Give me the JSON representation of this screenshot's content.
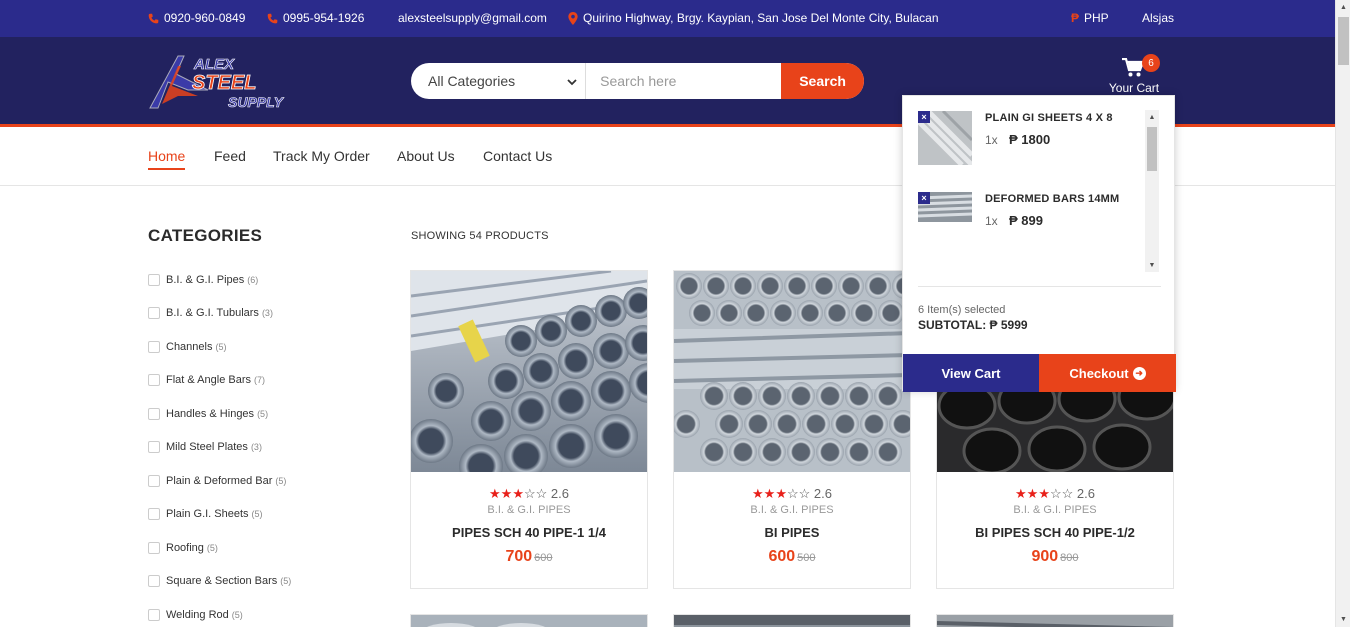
{
  "topbar": {
    "phone1": "0920-960-0849",
    "phone2": "0995-954-1926",
    "email": "alexsteelsupply@gmail.com",
    "address": "Quirino Highway, Brgy. Kaypian, San Jose Del Monte City, Bulacan",
    "currency": "PHP",
    "user": "Alsjas"
  },
  "logo": {
    "line1": "ALEX",
    "line2": "STEEL",
    "line3": "SUPPLY"
  },
  "search": {
    "category_selected": "All Categories",
    "placeholder": "Search here",
    "value": "",
    "button_label": "Search"
  },
  "cart": {
    "count": "6",
    "label": "Your Cart"
  },
  "nav": {
    "items": [
      {
        "label": "Home"
      },
      {
        "label": "Feed"
      },
      {
        "label": "Track My Order"
      },
      {
        "label": "About Us"
      },
      {
        "label": "Contact Us"
      }
    ]
  },
  "sidebar": {
    "title": "CATEGORIES",
    "categories": [
      {
        "label": "B.I. & G.I. Pipes",
        "count": "(6)"
      },
      {
        "label": "B.I. & G.I. Tubulars",
        "count": "(3)"
      },
      {
        "label": "Channels",
        "count": "(5)"
      },
      {
        "label": "Flat & Angle Bars",
        "count": "(7)"
      },
      {
        "label": "Handles & Hinges",
        "count": "(5)"
      },
      {
        "label": "Mild Steel Plates",
        "count": "(3)"
      },
      {
        "label": "Plain & Deformed Bar",
        "count": "(5)"
      },
      {
        "label": "Plain G.I. Sheets",
        "count": "(5)"
      },
      {
        "label": "Roofing",
        "count": "(5)"
      },
      {
        "label": "Square & Section Bars",
        "count": "(5)"
      },
      {
        "label": "Welding Rod",
        "count": "(5)"
      }
    ]
  },
  "main": {
    "showing": "SHOWING 54 PRODUCTS",
    "products": [
      {
        "rating": "2.6",
        "stars": 3,
        "category": "B.I. & G.I. PIPES",
        "name": "PIPES SCH 40 PIPE-1 1/4",
        "price": "700",
        "old_price": "600"
      },
      {
        "rating": "2.6",
        "stars": 3,
        "category": "B.I. & G.I. PIPES",
        "name": "BI PIPES",
        "price": "600",
        "old_price": "500"
      },
      {
        "rating": "2.6",
        "stars": 3,
        "category": "B.I. & G.I. PIPES",
        "name": "BI PIPES SCH 40 PIPE-1/2",
        "price": "900",
        "old_price": "800"
      }
    ]
  },
  "cart_dropdown": {
    "items": [
      {
        "name": "PLAIN GI SHEETS 4 X 8",
        "qty": "1x",
        "price": "₱ 1800"
      },
      {
        "name": "DEFORMED BARS 14MM",
        "qty": "1x",
        "price": "₱ 899"
      }
    ],
    "count_text": "6 Item(s) selected",
    "subtotal": "SUBTOTAL: ₱ 5999",
    "view_cart": "View Cart",
    "checkout": "Checkout"
  },
  "colors": {
    "topbar": "#2b2b8c",
    "header": "#22225f",
    "accent": "#e8431a"
  },
  "icons": {
    "phone": "phone-icon",
    "location": "location-pin-icon",
    "currency": "peso-icon",
    "cart": "shopping-cart-icon",
    "remove": "close-icon",
    "checkout": "arrow-circle-right-icon",
    "dropdown": "chevron-down-icon",
    "star": "star-icon"
  }
}
